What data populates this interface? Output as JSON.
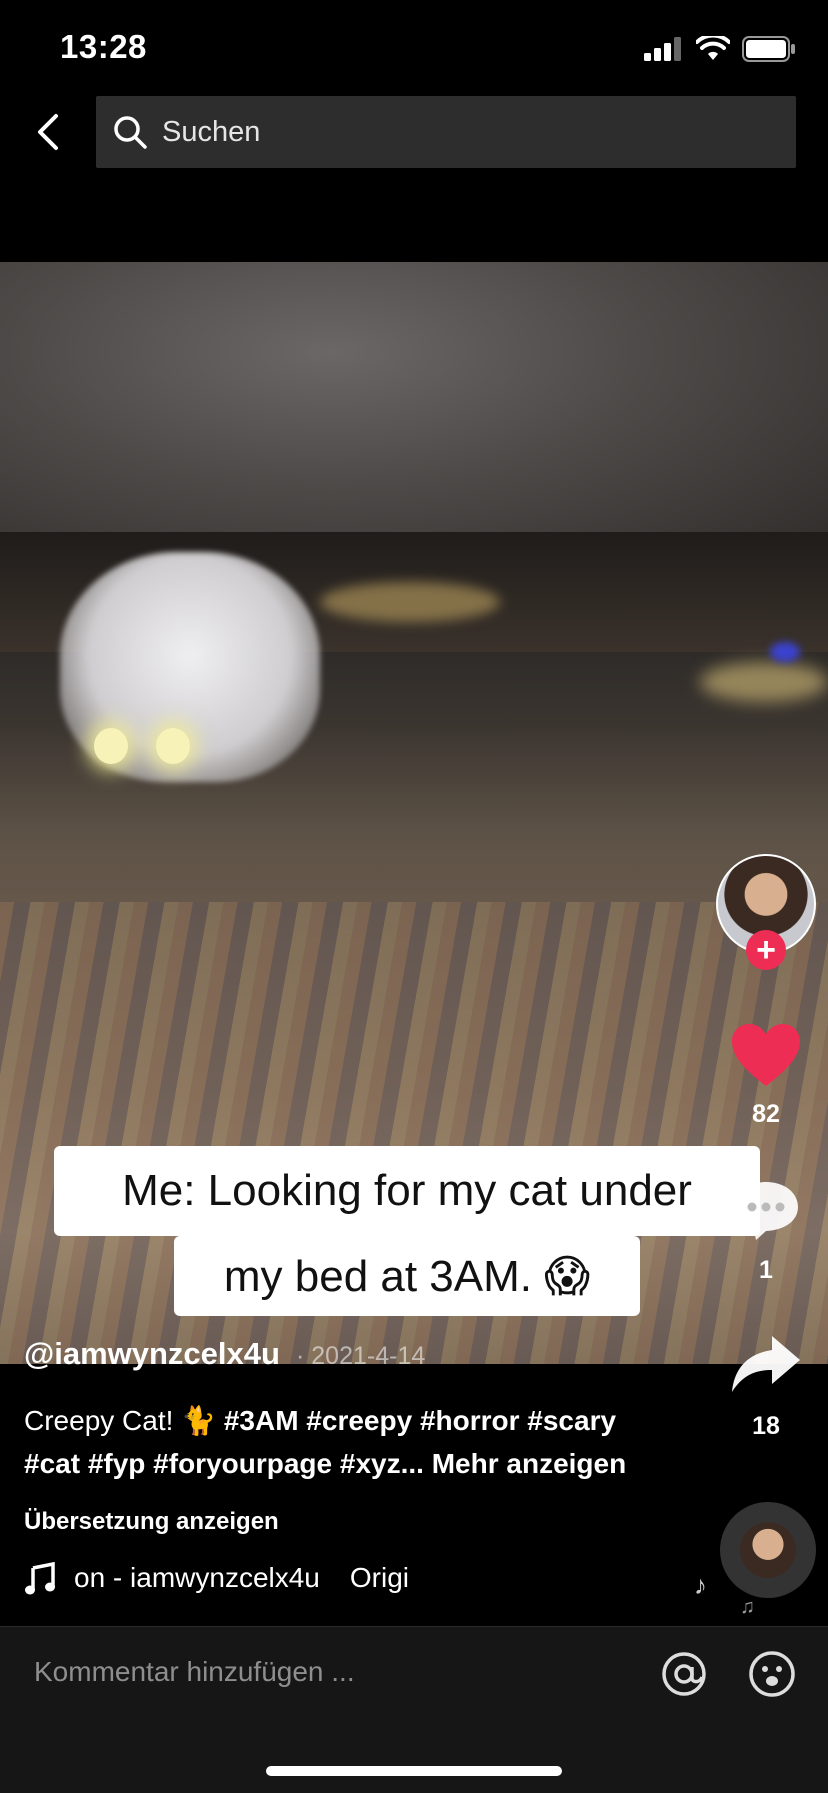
{
  "status": {
    "time": "13:28"
  },
  "search": {
    "placeholder": "Suchen"
  },
  "video": {
    "caption_line1": "Me: Looking for my cat under",
    "caption_line2": "my bed at 3AM. 😱"
  },
  "post": {
    "username": "@iamwynzcelx4u",
    "date": "· 2021-4-14",
    "desc_plain": "Creepy Cat! 🐈 ",
    "desc_tags1": "#3AM #creepy #horror #scary",
    "desc_tags2": "#cat #fyp #foryourpage #xyz...",
    "more": " Mehr anzeigen",
    "translate": "Übersetzung anzeigen",
    "music_line": "on - iamwynzcelx4u",
    "music_line2": "Origi"
  },
  "actions": {
    "likes": "82",
    "comments": "1",
    "shares": "18"
  },
  "comment_bar": {
    "placeholder": "Kommentar hinzufügen ..."
  },
  "colors": {
    "accent": "#ee2d55",
    "background": "#000000"
  },
  "icons": [
    "back-icon",
    "search-icon",
    "heart-icon",
    "comment-icon",
    "share-icon",
    "music-note-icon",
    "mention-icon",
    "emoji-icon"
  ]
}
